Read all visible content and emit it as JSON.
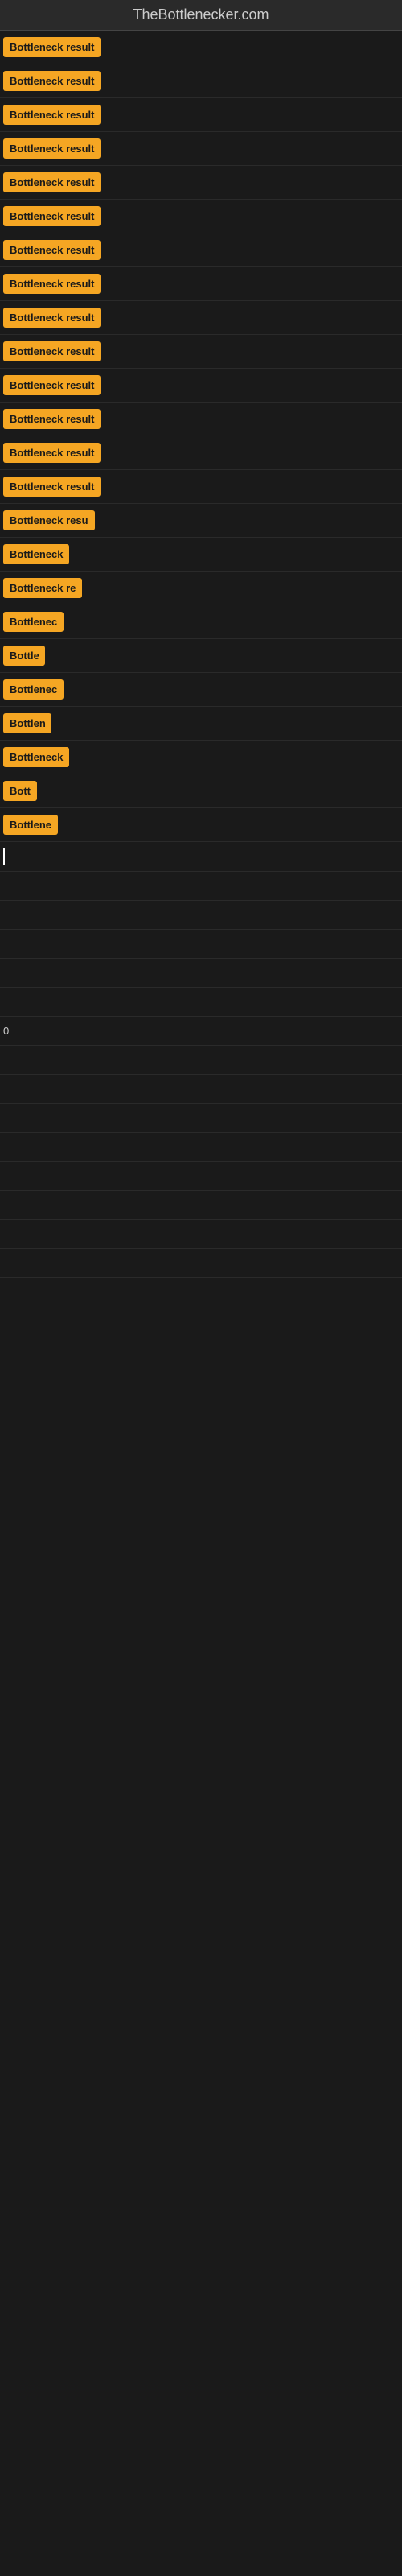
{
  "site": {
    "title": "TheBottlenecker.com"
  },
  "rows": [
    {
      "label": "Bottleneck result",
      "width": 140
    },
    {
      "label": "Bottleneck result",
      "width": 140
    },
    {
      "label": "Bottleneck result",
      "width": 140
    },
    {
      "label": "Bottleneck result",
      "width": 138
    },
    {
      "label": "Bottleneck result",
      "width": 140
    },
    {
      "label": "Bottleneck result",
      "width": 140
    },
    {
      "label": "Bottleneck result",
      "width": 140
    },
    {
      "label": "Bottleneck result",
      "width": 140
    },
    {
      "label": "Bottleneck result",
      "width": 140
    },
    {
      "label": "Bottleneck result",
      "width": 140
    },
    {
      "label": "Bottleneck result",
      "width": 140
    },
    {
      "label": "Bottleneck result",
      "width": 140
    },
    {
      "label": "Bottleneck result",
      "width": 140
    },
    {
      "label": "Bottleneck result",
      "width": 140
    },
    {
      "label": "Bottleneck resu",
      "width": 120
    },
    {
      "label": "Bottleneck",
      "width": 82
    },
    {
      "label": "Bottleneck re",
      "width": 104
    },
    {
      "label": "Bottlenec",
      "width": 76
    },
    {
      "label": "Bottle",
      "width": 52
    },
    {
      "label": "Bottlenec",
      "width": 76
    },
    {
      "label": "Bottlen",
      "width": 60
    },
    {
      "label": "Bottleneck",
      "width": 82
    },
    {
      "label": "Bott",
      "width": 42
    },
    {
      "label": "Bottlene",
      "width": 68
    },
    {
      "label": "",
      "width": 0,
      "cursor": true
    },
    {
      "label": "",
      "width": 0,
      "empty": true
    },
    {
      "label": "",
      "width": 0,
      "empty": true
    },
    {
      "label": "",
      "width": 0,
      "empty": true
    },
    {
      "label": "",
      "width": 0,
      "empty": true
    },
    {
      "label": "",
      "width": 0,
      "empty": true
    },
    {
      "label": "0",
      "width": 0,
      "char": true
    },
    {
      "label": "",
      "width": 0,
      "empty": true
    },
    {
      "label": "",
      "width": 0,
      "empty": true
    },
    {
      "label": "",
      "width": 0,
      "empty": true
    },
    {
      "label": "",
      "width": 0,
      "empty": true
    },
    {
      "label": "",
      "width": 0,
      "empty": true
    },
    {
      "label": "",
      "width": 0,
      "empty": true
    },
    {
      "label": "",
      "width": 0,
      "empty": true
    },
    {
      "label": "",
      "width": 0,
      "empty": true
    }
  ]
}
